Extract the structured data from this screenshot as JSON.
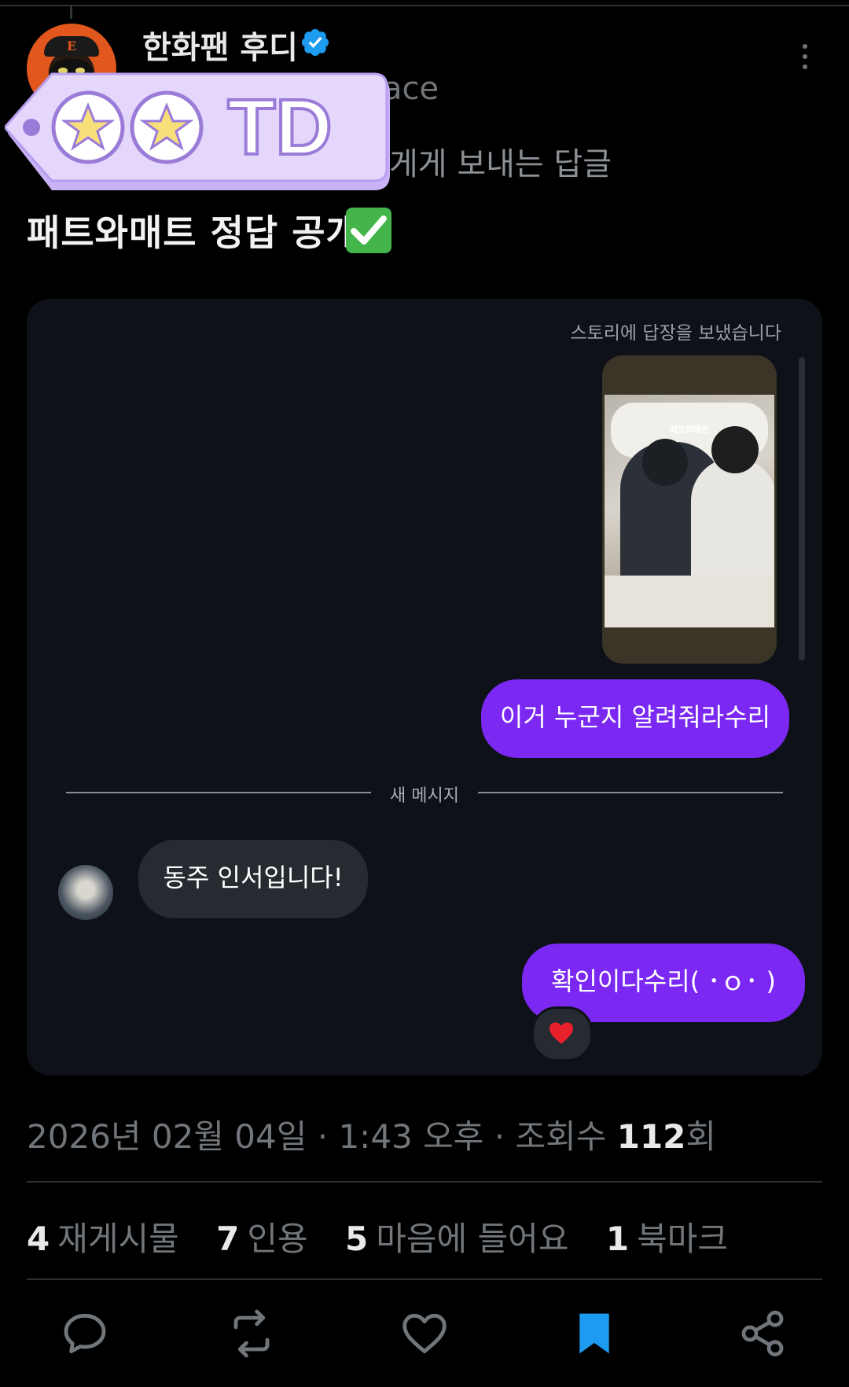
{
  "post": {
    "display_name": "한화팬 후디",
    "handle_fragment": "ace",
    "reply_fragment": "게게 보내는 답글",
    "headline": "패트와매트 정답 공개",
    "sticker_text": "TD",
    "timestamp_prefix": "2026년 02월 04일 · 1:43 오후 · 조회수 ",
    "view_count": "112",
    "view_unit": "회"
  },
  "dm": {
    "story_label": "스토리에 답장을 보냈습니다",
    "story_overlay_text": "패트와매트",
    "messages": [
      {
        "dir": "out",
        "text": "이거 누군지 알려줘라수리"
      },
      {
        "dir": "in",
        "text": "동주 인서입니다!"
      },
      {
        "dir": "out",
        "text": "확인이다수리( ･ｏ･ )"
      }
    ],
    "divider_label": "새 메시지",
    "reaction_icon": "heart-emoji"
  },
  "stats": [
    {
      "num": "4",
      "label": "재게시물"
    },
    {
      "num": "7",
      "label": "인용"
    },
    {
      "num": "5",
      "label": "마음에 들어요"
    },
    {
      "num": "1",
      "label": "북마크"
    }
  ],
  "colors": {
    "accent_purple": "#7a28f2",
    "verified_blue": "#1d9bf0",
    "bookmark_active": "#1d9bf0",
    "sticker_purple": "#c9b2f5"
  },
  "icons": [
    "reply-icon",
    "repost-icon",
    "like-icon",
    "bookmark-icon",
    "share-icon",
    "more-icon",
    "verified-icon"
  ]
}
